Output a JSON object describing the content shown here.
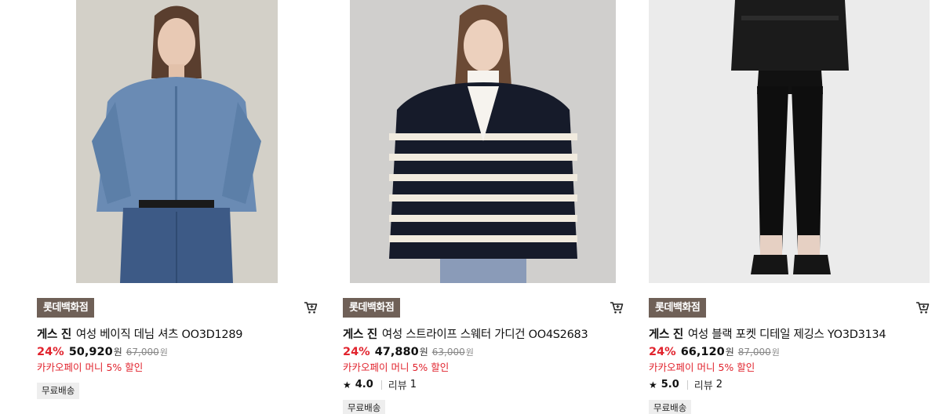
{
  "products": [
    {
      "store": "롯데백화점",
      "brand": "게스 진",
      "name": "여성 베이직 데님 셔츠 OO3D1289",
      "discount": "24%",
      "price": "50,920",
      "currency": "원",
      "original_price": "67,000",
      "promo": "카카오페이 머니 5% 할인",
      "shipping": "무료배송",
      "cart_icon": "cart-icon"
    },
    {
      "store": "롯데백화점",
      "brand": "게스 진",
      "name": "여성 스트라이프 스웨터 가디건 OO4S2683",
      "discount": "24%",
      "price": "47,880",
      "currency": "원",
      "original_price": "63,000",
      "promo": "카카오페이 머니 5% 할인",
      "rating": "4.0",
      "review_label": "리뷰",
      "review_count": "1",
      "shipping": "무료배송",
      "cart_icon": "cart-icon"
    },
    {
      "store": "롯데백화점",
      "brand": "게스 진",
      "name": "여성 블랙 포켓 디테일 제깅스 YO3D3134",
      "discount": "24%",
      "price": "66,120",
      "currency": "원",
      "original_price": "87,000",
      "promo": "카카오페이 머니 5% 할인",
      "rating": "5.0",
      "review_label": "리뷰",
      "review_count": "2",
      "shipping": "무료배송",
      "cart_icon": "cart-icon"
    }
  ],
  "colors": {
    "badge_bg": "#6f6057",
    "discount": "#e1232d",
    "promo": "#e1232d"
  }
}
